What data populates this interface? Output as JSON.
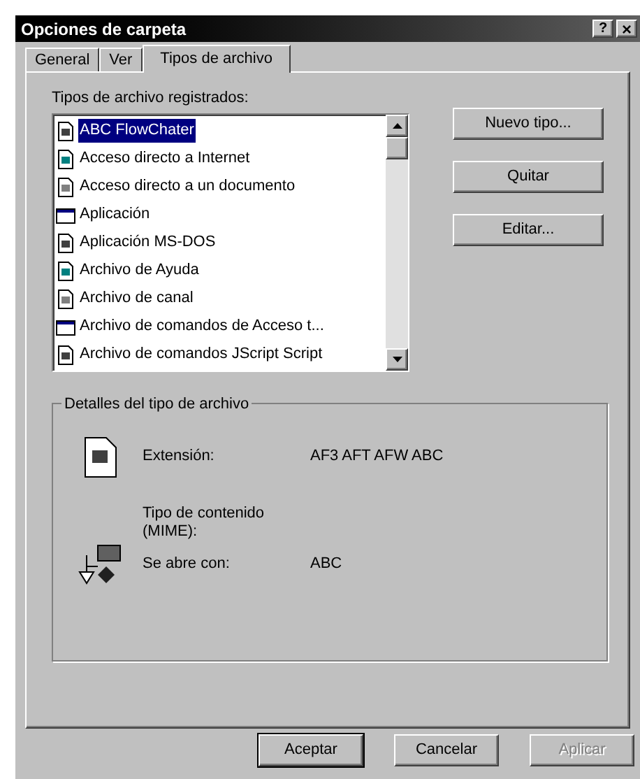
{
  "window": {
    "title": "Opciones de carpeta",
    "help_button": "?",
    "close_button": "×"
  },
  "tabs": [
    {
      "label": "General",
      "selected": false
    },
    {
      "label": "Ver",
      "selected": false
    },
    {
      "label": "Tipos de archivo",
      "selected": true
    }
  ],
  "file_types": {
    "label": "Tipos de archivo registrados:",
    "items": [
      {
        "label": "ABC FlowChater",
        "selected": true
      },
      {
        "label": "Acceso directo a Internet",
        "selected": false
      },
      {
        "label": "Acceso directo a un documento",
        "selected": false
      },
      {
        "label": "Aplicación",
        "selected": false
      },
      {
        "label": "Aplicación MS-DOS",
        "selected": false
      },
      {
        "label": "Archivo de Ayuda",
        "selected": false
      },
      {
        "label": "Archivo de canal",
        "selected": false
      },
      {
        "label": "Archivo de comandos de Acceso t...",
        "selected": false
      },
      {
        "label": "Archivo de comandos JScript Script",
        "selected": false
      }
    ]
  },
  "side_buttons": [
    {
      "label": "Nuevo tipo..."
    },
    {
      "label": "Quitar"
    },
    {
      "label": "Editar..."
    }
  ],
  "details": {
    "title": "Detalles del tipo de archivo",
    "rows": [
      {
        "label": "Extensión:",
        "value": "AF3 AFT AFW ABC"
      },
      {
        "label": "Tipo de contenido (MIME):"
      },
      {
        "label": "Se abre con:",
        "value": "ABC"
      }
    ]
  },
  "buttons": [
    {
      "label": "Aceptar",
      "disabled": false
    },
    {
      "label": "Cancelar",
      "disabled": false
    },
    {
      "label": "Aplicar",
      "disabled": true
    }
  ]
}
